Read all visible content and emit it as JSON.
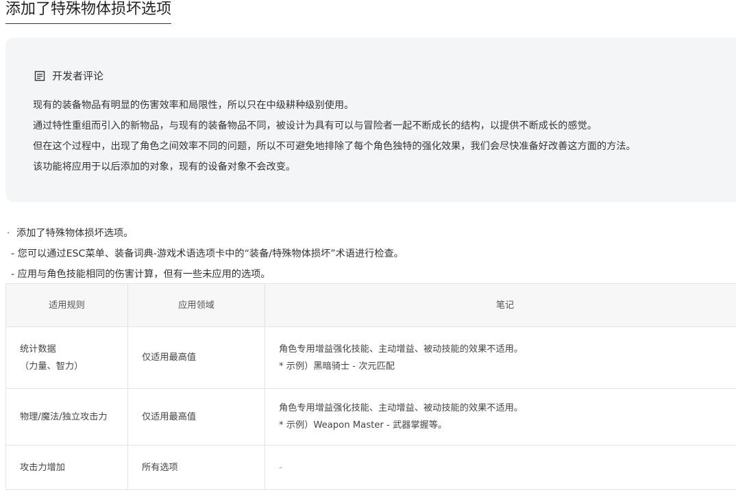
{
  "title": "添加了特殊物体损坏选项",
  "dev_comment": {
    "icon": "note-icon",
    "heading": "开发者评论",
    "lines": [
      "现有的装备物品有明显的伤害效率和局限性，所以只在中级耕种级别使用。",
      "通过特性重组而引入的新物品，与现有的装备物品不同，被设计为具有可以与冒险者一起不断成长的结构，以提供不断成长的感觉。",
      "但在这个过程中，出现了角色之间效率不同的问题，所以不可避免地排除了每个角色独特的强化效果，我们会尽快准备好改善这方面的方法。",
      "该功能将应用于以后添加的对象，现有的设备对象不会改变。"
    ]
  },
  "bullets": {
    "main": "添加了特殊物体损坏选项。",
    "subs": [
      "- 您可以通过ESC菜单、装备词典-游戏术语选项卡中的“装备/特殊物体损坏”术语进行检查。",
      "- 应用与角色技能相同的伤害计算，但有一些未应用的选项。"
    ]
  },
  "table": {
    "headers": [
      "适用规则",
      "应用领域",
      "笔记"
    ],
    "rows": [
      {
        "rule_lines": [
          "统计数据",
          "（力量、智力）"
        ],
        "scope": "仅适用最高值",
        "note_lines": [
          "角色专用增益强化技能、主动增益、被动技能的效果不适用。",
          "* 示例）黑暗骑士 - 次元匹配"
        ]
      },
      {
        "rule_lines": [
          "物理/魔法/独立攻击力"
        ],
        "scope": "仅适用最高值",
        "note_lines": [
          "角色专用增益强化技能、主动增益、被动技能的效果不适用。",
          "* 示例）Weapon Master - 武器掌握等。"
        ]
      },
      {
        "rule_lines": [
          "攻击力增加"
        ],
        "scope": "所有选项",
        "note_lines": [
          "-"
        ]
      }
    ]
  }
}
